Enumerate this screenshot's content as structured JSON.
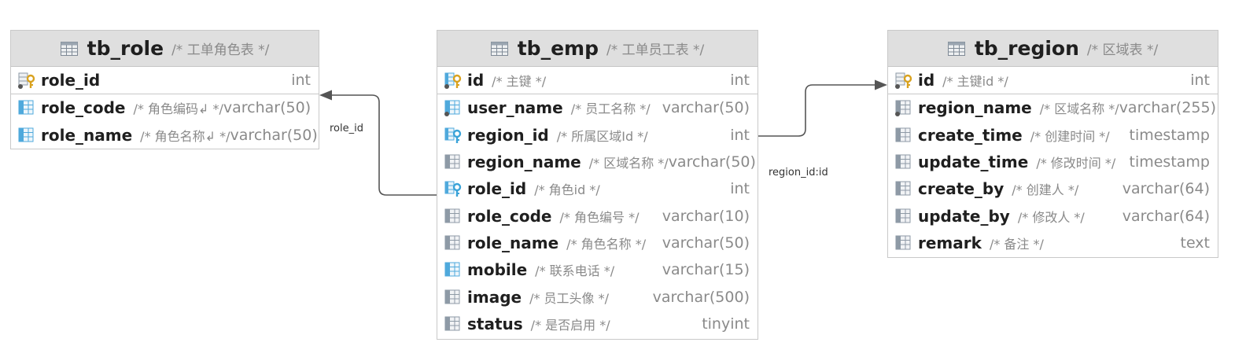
{
  "tables": {
    "tb_role": {
      "name": "tb_role",
      "comment": "/* 工单角色表 */",
      "columns": [
        {
          "name": "role_id",
          "comment": "",
          "type": "int"
        },
        {
          "name": "role_code",
          "comment": "/* 角色编码↲ */",
          "type": "varchar(50)"
        },
        {
          "name": "role_name",
          "comment": "/* 角色名称↲ */",
          "type": "varchar(50)"
        }
      ]
    },
    "tb_emp": {
      "name": "tb_emp",
      "comment": "/* 工单员工表 */",
      "columns": [
        {
          "name": "id",
          "comment": "/* 主键 */",
          "type": "int"
        },
        {
          "name": "user_name",
          "comment": "/* 员工名称 */",
          "type": "varchar(50)"
        },
        {
          "name": "region_id",
          "comment": "/* 所属区域Id */",
          "type": "int"
        },
        {
          "name": "region_name",
          "comment": "/* 区域名称 */",
          "type": "varchar(50)"
        },
        {
          "name": "role_id",
          "comment": "/* 角色id */",
          "type": "int"
        },
        {
          "name": "role_code",
          "comment": "/* 角色编号 */",
          "type": "varchar(10)"
        },
        {
          "name": "role_name",
          "comment": "/* 角色名称 */",
          "type": "varchar(50)"
        },
        {
          "name": "mobile",
          "comment": "/* 联系电话 */",
          "type": "varchar(15)"
        },
        {
          "name": "image",
          "comment": "/* 员工头像 */",
          "type": "varchar(500)"
        },
        {
          "name": "status",
          "comment": "/* 是否启用 */",
          "type": "tinyint"
        }
      ]
    },
    "tb_region": {
      "name": "tb_region",
      "comment": "/* 区域表 */",
      "columns": [
        {
          "name": "id",
          "comment": "/* 主键id */",
          "type": "int"
        },
        {
          "name": "region_name",
          "comment": "/* 区域名称 */",
          "type": "varchar(255)"
        },
        {
          "name": "create_time",
          "comment": "/* 创建时间 */",
          "type": "timestamp"
        },
        {
          "name": "update_time",
          "comment": "/* 修改时间 */",
          "type": "timestamp"
        },
        {
          "name": "create_by",
          "comment": "/* 创建人 */",
          "type": "varchar(64)"
        },
        {
          "name": "update_by",
          "comment": "/* 修改人 */",
          "type": "varchar(64)"
        },
        {
          "name": "remark",
          "comment": "/* 备注 */",
          "type": "text"
        }
      ]
    }
  },
  "connections": [
    {
      "label": "role_id"
    },
    {
      "label": "region_id:id"
    }
  ],
  "icons": {
    "table": "table-icon",
    "column": "column-icon",
    "primary_key": "primary-key-icon",
    "foreign_key": "foreign-key-icon",
    "not_null_marker": "not-null-dot-icon"
  },
  "colors": {
    "header_bg": "#dfdfdf",
    "key_gold": "#d9a21f",
    "key_blue": "#3aa3d8",
    "column_icon": "#8e9aa6",
    "column_icon_blue": "#4fa9dc",
    "comment_gray": "#8a8a8a",
    "line": "#555555"
  }
}
